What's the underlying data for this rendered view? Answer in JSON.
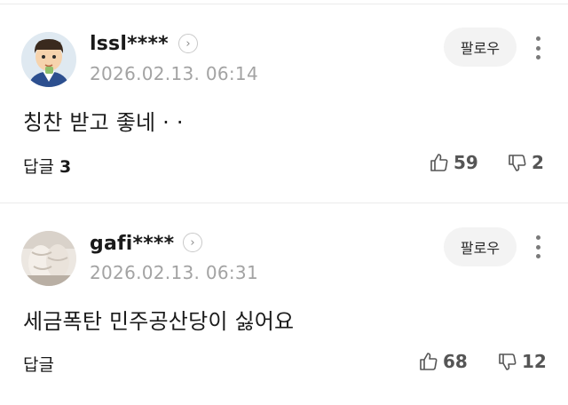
{
  "comments": [
    {
      "username": "lssl****",
      "timestamp": "2026.02.13. 06:14",
      "follow_label": "팔로우",
      "text": "칭찬 받고 좋네 · ·",
      "reply_label": "답글",
      "reply_count": "3",
      "likes": "59",
      "dislikes": "2"
    },
    {
      "username": "gafi****",
      "timestamp": "2026.02.13. 06:31",
      "follow_label": "팔로우",
      "text": "세금폭탄 민주공산당이 싫어요",
      "reply_label": "답글",
      "reply_count": "",
      "likes": "68",
      "dislikes": "12"
    }
  ],
  "icons": {
    "profile_chevron": "chevron-right-icon",
    "more": "more-vertical-icon",
    "like": "thumbs-up-icon",
    "dislike": "thumbs-down-icon"
  }
}
